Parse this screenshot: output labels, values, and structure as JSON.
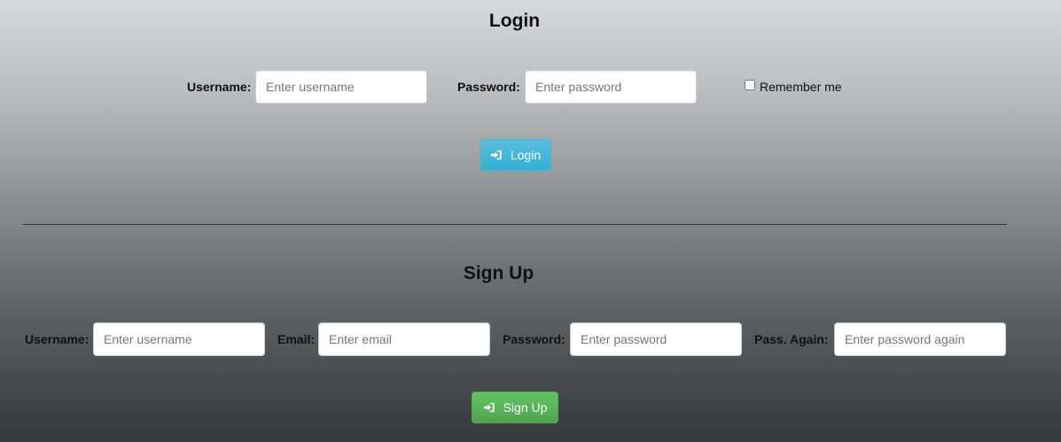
{
  "login": {
    "title": "Login",
    "username_label": "Username:",
    "username_placeholder": "Enter username",
    "password_label": "Password:",
    "password_placeholder": "Enter password",
    "remember_label": "Remember me",
    "button_label": "Login",
    "button_icon": "sign-in-icon"
  },
  "signup": {
    "title": "Sign Up",
    "username_label": "Username:",
    "username_placeholder": "Enter username",
    "email_label": "Email:",
    "email_placeholder": "Enter email",
    "password_label": "Password:",
    "password_placeholder": "Enter password",
    "password_again_label": "Pass. Again:",
    "password_again_placeholder": "Enter password again",
    "button_label": "Sign Up",
    "button_icon": "sign-in-icon"
  },
  "colors": {
    "login_button": "#5bc0de",
    "signup_button": "#5cb85c"
  }
}
